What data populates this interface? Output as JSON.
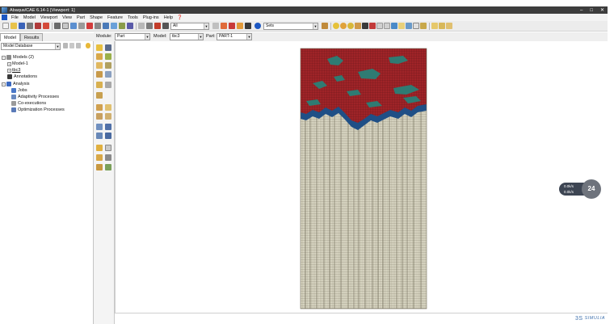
{
  "window": {
    "title": "Abaqus/CAE 6.14-1 [Viewport: 1]",
    "minimize_glyph": "–",
    "maximize_glyph": "□",
    "close_glyph": "✕"
  },
  "menubar": {
    "items": [
      "File",
      "Model",
      "Viewport",
      "View",
      "Part",
      "Shape",
      "Feature",
      "Tools",
      "Plug-ins",
      "Help"
    ],
    "help_glyph": "❓"
  },
  "toolbar": {
    "filter_combo": "All",
    "sets_combo": "Sets"
  },
  "tabs": {
    "model": "Model",
    "results": "Results"
  },
  "context": {
    "module_label": "Module:",
    "module_value": "Part",
    "model_label": "Model:",
    "model_value": "tbc3",
    "part_label": "Part:",
    "part_value": "PART-1"
  },
  "tree": {
    "header_combo": "Model Database",
    "models": "Models (2)",
    "model1": "Model-1",
    "model2": "tbc3",
    "annotations": "Annotations",
    "analysis": "Analysis",
    "jobs": "Jobs",
    "adaptivity": "Adaptivity Processes",
    "coexec": "Co-executions",
    "optimization": "Optimization Processes"
  },
  "colors": {
    "mesh_base": "#d9d6c3",
    "mesh_grid": "#6f6a58",
    "coat_red": "#9f2428",
    "coat_blue": "#1f4f86",
    "coat_teal": "#2f7b73",
    "accent_blue": "#1c57c2"
  },
  "overlay": {
    "line1": "0.0k/s",
    "line2": "0.0k/s",
    "badge": "24"
  },
  "vendor": {
    "name": "SIMULIA"
  }
}
